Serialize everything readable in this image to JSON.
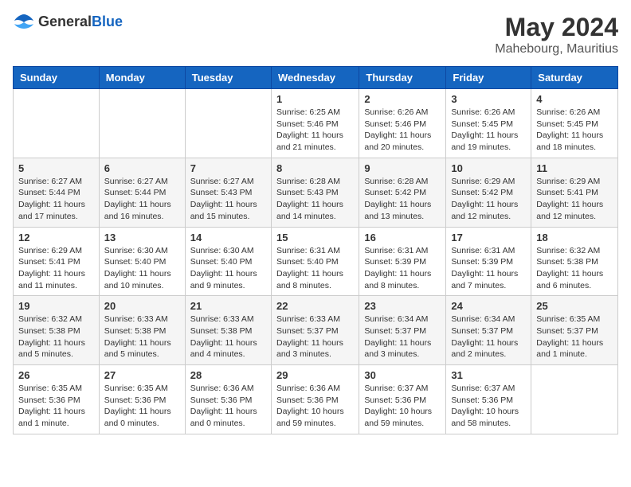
{
  "header": {
    "logo_general": "General",
    "logo_blue": "Blue",
    "month_year": "May 2024",
    "location": "Mahebourg, Mauritius"
  },
  "days_of_week": [
    "Sunday",
    "Monday",
    "Tuesday",
    "Wednesday",
    "Thursday",
    "Friday",
    "Saturday"
  ],
  "weeks": [
    [
      {
        "day": "",
        "info": ""
      },
      {
        "day": "",
        "info": ""
      },
      {
        "day": "",
        "info": ""
      },
      {
        "day": "1",
        "info": "Sunrise: 6:25 AM\nSunset: 5:46 PM\nDaylight: 11 hours and 21 minutes."
      },
      {
        "day": "2",
        "info": "Sunrise: 6:26 AM\nSunset: 5:46 PM\nDaylight: 11 hours and 20 minutes."
      },
      {
        "day": "3",
        "info": "Sunrise: 6:26 AM\nSunset: 5:45 PM\nDaylight: 11 hours and 19 minutes."
      },
      {
        "day": "4",
        "info": "Sunrise: 6:26 AM\nSunset: 5:45 PM\nDaylight: 11 hours and 18 minutes."
      }
    ],
    [
      {
        "day": "5",
        "info": "Sunrise: 6:27 AM\nSunset: 5:44 PM\nDaylight: 11 hours and 17 minutes."
      },
      {
        "day": "6",
        "info": "Sunrise: 6:27 AM\nSunset: 5:44 PM\nDaylight: 11 hours and 16 minutes."
      },
      {
        "day": "7",
        "info": "Sunrise: 6:27 AM\nSunset: 5:43 PM\nDaylight: 11 hours and 15 minutes."
      },
      {
        "day": "8",
        "info": "Sunrise: 6:28 AM\nSunset: 5:43 PM\nDaylight: 11 hours and 14 minutes."
      },
      {
        "day": "9",
        "info": "Sunrise: 6:28 AM\nSunset: 5:42 PM\nDaylight: 11 hours and 13 minutes."
      },
      {
        "day": "10",
        "info": "Sunrise: 6:29 AM\nSunset: 5:42 PM\nDaylight: 11 hours and 12 minutes."
      },
      {
        "day": "11",
        "info": "Sunrise: 6:29 AM\nSunset: 5:41 PM\nDaylight: 11 hours and 12 minutes."
      }
    ],
    [
      {
        "day": "12",
        "info": "Sunrise: 6:29 AM\nSunset: 5:41 PM\nDaylight: 11 hours and 11 minutes."
      },
      {
        "day": "13",
        "info": "Sunrise: 6:30 AM\nSunset: 5:40 PM\nDaylight: 11 hours and 10 minutes."
      },
      {
        "day": "14",
        "info": "Sunrise: 6:30 AM\nSunset: 5:40 PM\nDaylight: 11 hours and 9 minutes."
      },
      {
        "day": "15",
        "info": "Sunrise: 6:31 AM\nSunset: 5:40 PM\nDaylight: 11 hours and 8 minutes."
      },
      {
        "day": "16",
        "info": "Sunrise: 6:31 AM\nSunset: 5:39 PM\nDaylight: 11 hours and 8 minutes."
      },
      {
        "day": "17",
        "info": "Sunrise: 6:31 AM\nSunset: 5:39 PM\nDaylight: 11 hours and 7 minutes."
      },
      {
        "day": "18",
        "info": "Sunrise: 6:32 AM\nSunset: 5:38 PM\nDaylight: 11 hours and 6 minutes."
      }
    ],
    [
      {
        "day": "19",
        "info": "Sunrise: 6:32 AM\nSunset: 5:38 PM\nDaylight: 11 hours and 5 minutes."
      },
      {
        "day": "20",
        "info": "Sunrise: 6:33 AM\nSunset: 5:38 PM\nDaylight: 11 hours and 5 minutes."
      },
      {
        "day": "21",
        "info": "Sunrise: 6:33 AM\nSunset: 5:38 PM\nDaylight: 11 hours and 4 minutes."
      },
      {
        "day": "22",
        "info": "Sunrise: 6:33 AM\nSunset: 5:37 PM\nDaylight: 11 hours and 3 minutes."
      },
      {
        "day": "23",
        "info": "Sunrise: 6:34 AM\nSunset: 5:37 PM\nDaylight: 11 hours and 3 minutes."
      },
      {
        "day": "24",
        "info": "Sunrise: 6:34 AM\nSunset: 5:37 PM\nDaylight: 11 hours and 2 minutes."
      },
      {
        "day": "25",
        "info": "Sunrise: 6:35 AM\nSunset: 5:37 PM\nDaylight: 11 hours and 1 minute."
      }
    ],
    [
      {
        "day": "26",
        "info": "Sunrise: 6:35 AM\nSunset: 5:36 PM\nDaylight: 11 hours and 1 minute."
      },
      {
        "day": "27",
        "info": "Sunrise: 6:35 AM\nSunset: 5:36 PM\nDaylight: 11 hours and 0 minutes."
      },
      {
        "day": "28",
        "info": "Sunrise: 6:36 AM\nSunset: 5:36 PM\nDaylight: 11 hours and 0 minutes."
      },
      {
        "day": "29",
        "info": "Sunrise: 6:36 AM\nSunset: 5:36 PM\nDaylight: 10 hours and 59 minutes."
      },
      {
        "day": "30",
        "info": "Sunrise: 6:37 AM\nSunset: 5:36 PM\nDaylight: 10 hours and 59 minutes."
      },
      {
        "day": "31",
        "info": "Sunrise: 6:37 AM\nSunset: 5:36 PM\nDaylight: 10 hours and 58 minutes."
      },
      {
        "day": "",
        "info": ""
      }
    ]
  ]
}
